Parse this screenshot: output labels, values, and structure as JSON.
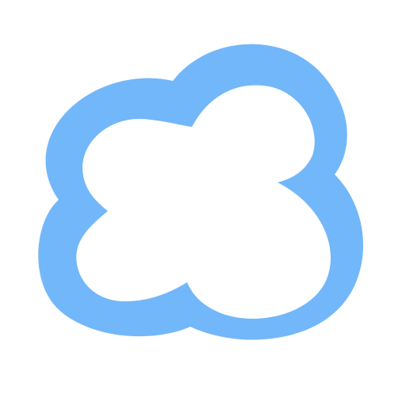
{
  "logo": {
    "icon": "cloud-icon",
    "colors": {
      "outline": "#72b7f9",
      "fill": "#ffffff",
      "background": "#ffffff"
    }
  }
}
